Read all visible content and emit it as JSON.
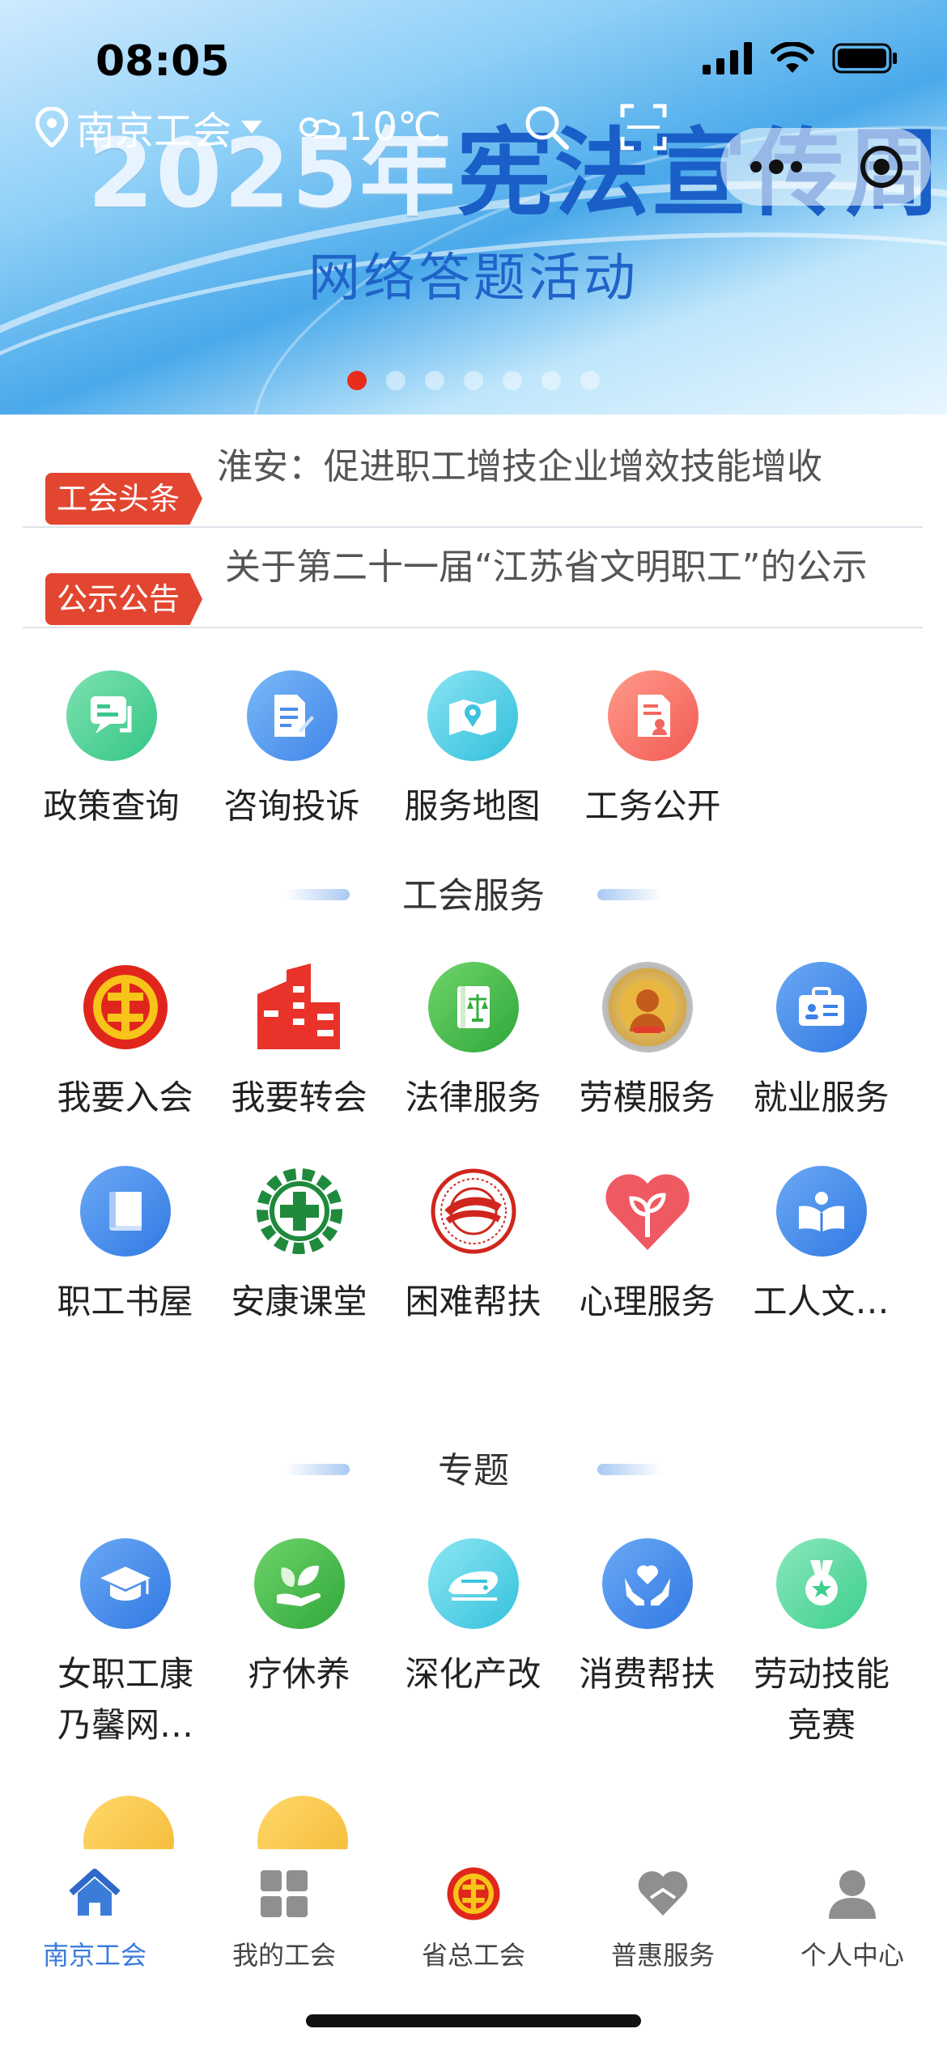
{
  "status_bar": {
    "time": "08:05"
  },
  "header": {
    "location": "南京工会",
    "weather": "10℃"
  },
  "banner": {
    "title_year": "2025年",
    "title_text": "宪法宣传周",
    "subtitle": "网络答题活动",
    "slide_count": 7,
    "active_slide": 1
  },
  "news": [
    {
      "tag": "工会头条",
      "text": "淮安：促进职工增技企业增效技能增收"
    },
    {
      "tag": "公示公告",
      "text": "关于第二十一届“江苏省文明职工”的公示"
    }
  ],
  "quick_links": [
    {
      "label": "政策查询",
      "icon": "chat-icon"
    },
    {
      "label": "咨询投诉",
      "icon": "edit-document-icon"
    },
    {
      "label": "服务地图",
      "icon": "map-icon"
    },
    {
      "label": "工务公开",
      "icon": "public-document-icon"
    }
  ],
  "union_services": {
    "title": "工会服务",
    "items": [
      {
        "label": "我要入会",
        "icon": "union-emblem-icon"
      },
      {
        "label": "我要转会",
        "icon": "building-icon"
      },
      {
        "label": "法律服务",
        "icon": "law-book-icon"
      },
      {
        "label": "劳模服务",
        "icon": "model-worker-badge-icon"
      },
      {
        "label": "就业服务",
        "icon": "briefcase-icon"
      },
      {
        "label": "职工书屋",
        "icon": "book-icon"
      },
      {
        "label": "安康课堂",
        "icon": "gear-cross-icon"
      },
      {
        "label": "困难帮扶",
        "icon": "aid-emblem-icon"
      },
      {
        "label": "心理服务",
        "icon": "heart-sprout-icon"
      },
      {
        "label": "工人文…",
        "icon": "reading-icon"
      }
    ]
  },
  "topics": {
    "title": "专题",
    "items": [
      {
        "label": "女职工康乃馨网…",
        "icon": "graduation-cap-icon"
      },
      {
        "label": "疗休养",
        "icon": "leaf-hand-icon"
      },
      {
        "label": "深化产改",
        "icon": "train-icon"
      },
      {
        "label": "消费帮扶",
        "icon": "helping-hands-icon"
      },
      {
        "label": "劳动技能竞赛",
        "icon": "medal-icon"
      }
    ]
  },
  "tabbar": [
    {
      "label": "南京工会",
      "icon": "home-icon",
      "active": true
    },
    {
      "label": "我的工会",
      "icon": "grid-icon",
      "active": false
    },
    {
      "label": "省总工会",
      "icon": "union-emblem-icon",
      "active": false
    },
    {
      "label": "普惠服务",
      "icon": "heart-hands-icon",
      "active": false
    },
    {
      "label": "个人中心",
      "icon": "person-icon",
      "active": false
    }
  ],
  "colors": {
    "accent": "#3b7cd9",
    "tag_red": "#e34630",
    "active_dot": "#e82d1b"
  }
}
